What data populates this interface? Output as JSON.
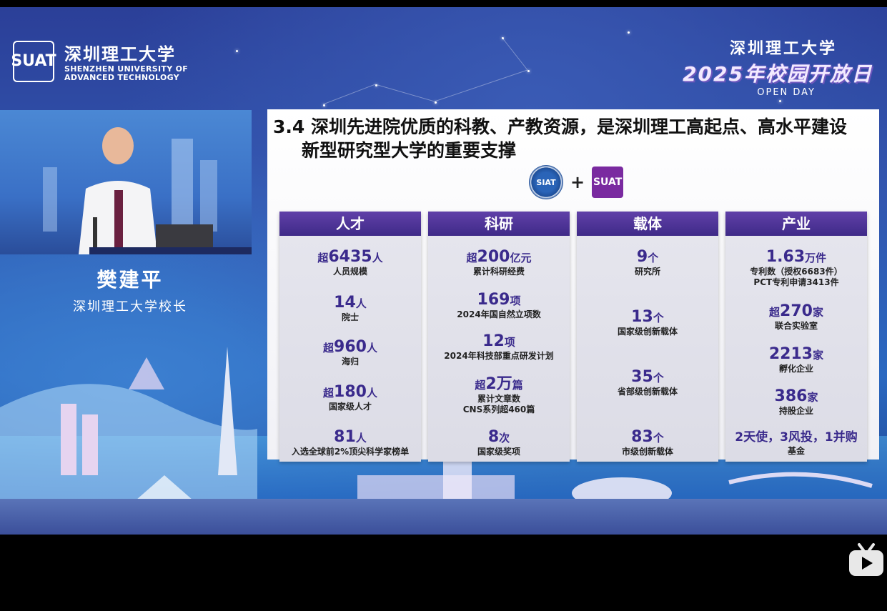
{
  "logo": {
    "mark": "SUAT",
    "name_cn": "深圳理工大学",
    "name_en_line1": "SHENZHEN UNIVERSITY OF",
    "name_en_line2": "ADVANCED TECHNOLOGY"
  },
  "open_day": {
    "line1": "深圳理工大学",
    "line2": "2025年校园开放日",
    "line3": "OPEN DAY"
  },
  "speaker": {
    "name": "樊建平",
    "title": "深圳理工大学校长"
  },
  "slide": {
    "title_line1": "3.4 深圳先进院优质的科教、产教资源，是深圳理工高起点、高水平建设",
    "title_line2": "新型研究型大学的重要支撑",
    "plus": "+",
    "siat_label": "SIAT",
    "suat_label": "SUAT",
    "columns": [
      {
        "header": "人才",
        "items": [
          {
            "pre": "超",
            "num": "6435",
            "unit": "人",
            "desc": [
              "人员规模"
            ]
          },
          {
            "pre": "",
            "num": "14",
            "unit": "人",
            "desc": [
              "院士"
            ]
          },
          {
            "pre": "超",
            "num": "960",
            "unit": "人",
            "desc": [
              "海归"
            ]
          },
          {
            "pre": "超",
            "num": "180",
            "unit": "人",
            "desc": [
              "国家级人才"
            ]
          },
          {
            "pre": "",
            "num": "81",
            "unit": "人",
            "desc": [
              "入选全球前2%顶尖科学家榜单"
            ]
          }
        ]
      },
      {
        "header": "科研",
        "items": [
          {
            "pre": "超",
            "num": "200",
            "unit": "亿元",
            "desc": [
              "累计科研经费"
            ]
          },
          {
            "pre": "",
            "num": "169",
            "unit": "项",
            "desc": [
              "2024年国自然立项数"
            ]
          },
          {
            "pre": "",
            "num": "12",
            "unit": "项",
            "desc": [
              "2024年科技部重点研发计划"
            ]
          },
          {
            "pre": "超",
            "num": "2万",
            "unit": "篇",
            "desc": [
              "累计文章数",
              "CNS系列超460篇"
            ]
          },
          {
            "pre": "",
            "num": "8",
            "unit": "次",
            "desc": [
              "国家级奖项"
            ]
          }
        ]
      },
      {
        "header": "载体",
        "items": [
          {
            "pre": "",
            "num": "9",
            "unit": "个",
            "desc": [
              "研究所"
            ]
          },
          {
            "pre": "",
            "num": "13",
            "unit": "个",
            "desc": [
              "国家级创新载体"
            ]
          },
          {
            "pre": "",
            "num": "35",
            "unit": "个",
            "desc": [
              "省部级创新载体"
            ]
          },
          {
            "pre": "",
            "num": "83",
            "unit": "个",
            "desc": [
              "市级创新载体"
            ]
          }
        ]
      },
      {
        "header": "产业",
        "items": [
          {
            "pre": "",
            "num": "1.63",
            "unit": "万件",
            "desc": [
              "专利数（授权6683件）",
              "PCT专利申请3413件"
            ]
          },
          {
            "pre": "超",
            "num": "270",
            "unit": "家",
            "desc": [
              "联合实验室"
            ]
          },
          {
            "pre": "",
            "num": "2213",
            "unit": "家",
            "desc": [
              "孵化企业"
            ]
          },
          {
            "pre": "",
            "num": "386",
            "unit": "家",
            "desc": [
              "持股企业"
            ]
          },
          {
            "pre": "",
            "num": "",
            "unit": "",
            "big": "2天使，3风投，1并购",
            "desc": [
              "基金"
            ]
          }
        ]
      }
    ]
  },
  "colors": {
    "header_purple": "#4a2f94",
    "number_purple": "#3a2a8c",
    "background_blue": "#2f55ad"
  }
}
